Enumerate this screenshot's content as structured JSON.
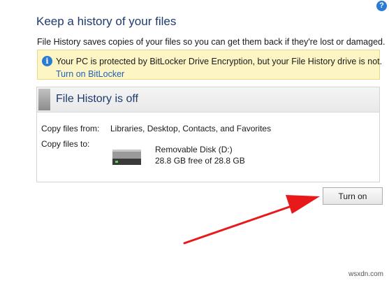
{
  "header": {
    "title": "Keep a history of your files",
    "description": "File History saves copies of your files so you can get them back if they're lost or damaged.",
    "help_icon": "?"
  },
  "banner": {
    "icon": "info-icon",
    "icon_glyph": "i",
    "message": "Your PC is protected by BitLocker Drive Encryption, but your File History drive is not.",
    "link": "Turn on BitLocker"
  },
  "status": {
    "title": "File History is off",
    "copy_from_label": "Copy files from:",
    "copy_from_value": "Libraries, Desktop, Contacts, and Favorites",
    "copy_to_label": "Copy files to:",
    "drive_name": "Removable Disk (D:)",
    "drive_space": "28.8 GB free of 28.8 GB"
  },
  "actions": {
    "turn_on_label": "Turn on"
  },
  "annotation": {
    "arrow_color": "#e8191b"
  },
  "watermark": "wsxdn.com"
}
